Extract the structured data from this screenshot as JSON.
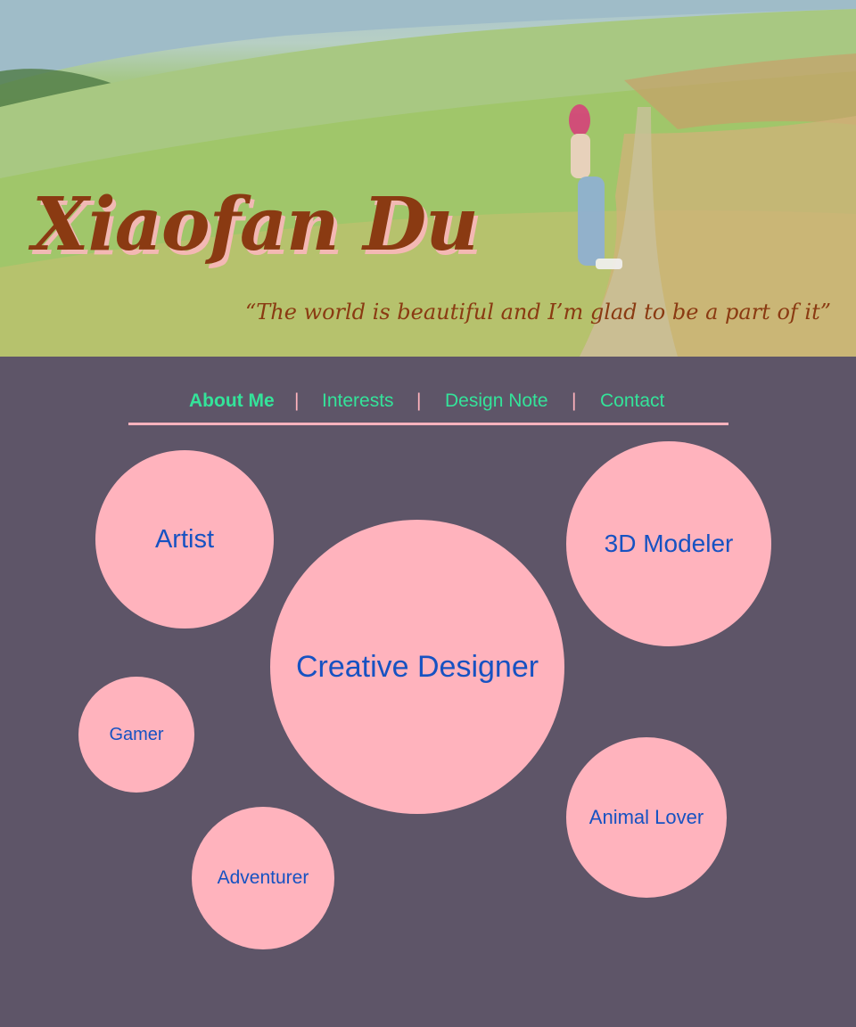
{
  "header": {
    "title": "Xiaofan Du",
    "quote": "“The world is beautiful and I’m glad to be a part of it”"
  },
  "nav": {
    "items": [
      {
        "label": "About Me",
        "active": true
      },
      {
        "label": "Interests",
        "active": false
      },
      {
        "label": "Design Note",
        "active": false
      },
      {
        "label": "Contact",
        "active": false
      }
    ],
    "separator": "|"
  },
  "bubbles": {
    "artist": "Artist",
    "creative_designer": "Creative Designer",
    "modeler": "3D Modeler",
    "gamer": "Gamer",
    "animal_lover": "Animal Lover",
    "adventurer": "Adventurer"
  },
  "colors": {
    "background": "#5e5568",
    "bubble": "#ffb3bd",
    "bubble_text": "#1652c2",
    "nav_text": "#34e39a",
    "title_text": "#8a3a12"
  }
}
